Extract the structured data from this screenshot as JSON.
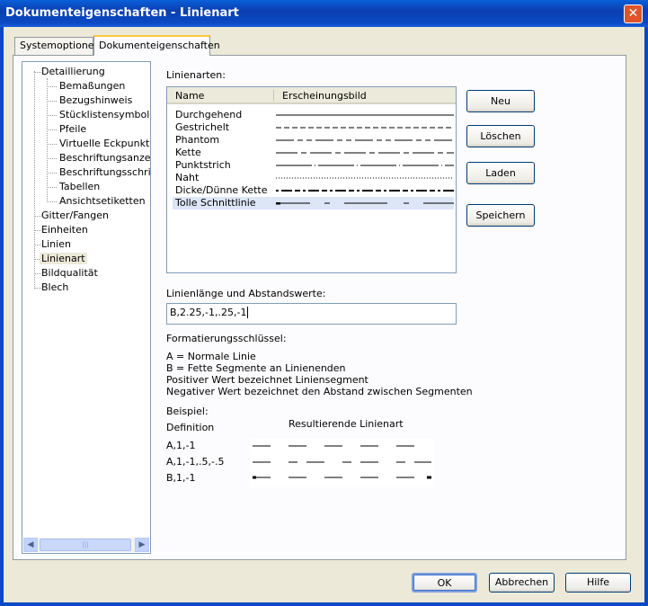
{
  "window": {
    "title": "Dokumenteigenschaften - Linienart",
    "close_glyph": "✕"
  },
  "tabs": [
    {
      "label": "Systemoptionen",
      "active": false
    },
    {
      "label": "Dokumenteigenschaften",
      "active": true
    }
  ],
  "tree": {
    "items": [
      {
        "label": "Detaillierung",
        "level": 0
      },
      {
        "label": "Bemaßungen",
        "level": 1
      },
      {
        "label": "Bezugshinweis",
        "level": 1
      },
      {
        "label": "Stücklistensymbole",
        "level": 1
      },
      {
        "label": "Pfeile",
        "level": 1
      },
      {
        "label": "Virtuelle Eckpunkte",
        "level": 1
      },
      {
        "label": "Beschriftungsanzeige",
        "level": 1
      },
      {
        "label": "Beschriftungsschriftart",
        "level": 1
      },
      {
        "label": "Tabellen",
        "level": 1
      },
      {
        "label": "Ansichtsetiketten",
        "level": 1
      },
      {
        "label": "Gitter/Fangen",
        "level": 0
      },
      {
        "label": "Einheiten",
        "level": 0
      },
      {
        "label": "Linien",
        "level": 0
      },
      {
        "label": "Linienart",
        "level": 0,
        "selected": true
      },
      {
        "label": "Bildqualität",
        "level": 0
      },
      {
        "label": "Blech",
        "level": 0
      }
    ],
    "scroll_left_glyph": "◀",
    "scroll_right_glyph": "▶",
    "scroll_grip_glyph": "|||"
  },
  "linestyles": {
    "section_label": "Linienarten:",
    "col_name": "Name",
    "col_appearance": "Erscheinungsbild",
    "rows": [
      {
        "name": "Durchgehend"
      },
      {
        "name": "Gestrichelt"
      },
      {
        "name": "Phantom"
      },
      {
        "name": "Kette"
      },
      {
        "name": "Punktstrich"
      },
      {
        "name": "Naht"
      },
      {
        "name": "Dicke/Dünne Kette"
      },
      {
        "name": "Tolle Schnittlinie",
        "selected": true
      }
    ]
  },
  "buttons": {
    "neu": "Neu",
    "loeschen": "Löschen",
    "laden": "Laden",
    "speichern": "Speichern",
    "ok": "OK",
    "abbrechen": "Abbrechen",
    "hilfe": "Hilfe"
  },
  "definition": {
    "label": "Linienlänge und Abstandswerte:",
    "value": "B,2.25,-1,.25,-1"
  },
  "format_key": {
    "label": "Formatierungsschlüssel:",
    "lines": [
      "A = Normale Linie",
      "B = Fette Segmente an Linienenden",
      "Positiver Wert bezeichnet Liniensegment",
      "Negativer Wert bezeichnet den Abstand zwischen Segmenten"
    ]
  },
  "example": {
    "label": "Beispiel:",
    "col_definition": "Definition",
    "col_result": "Resultierende Linienart",
    "rows": [
      {
        "definition": "A,1,-1"
      },
      {
        "definition": "A,1,-1,.5,-.5"
      },
      {
        "definition": "B,1,-1"
      }
    ]
  },
  "colors": {
    "titlebar": "#0b49c4",
    "dialog_bg": "#ece9d8",
    "selection": "#dde6f7",
    "active_tab_accent": "#ffc83c"
  }
}
